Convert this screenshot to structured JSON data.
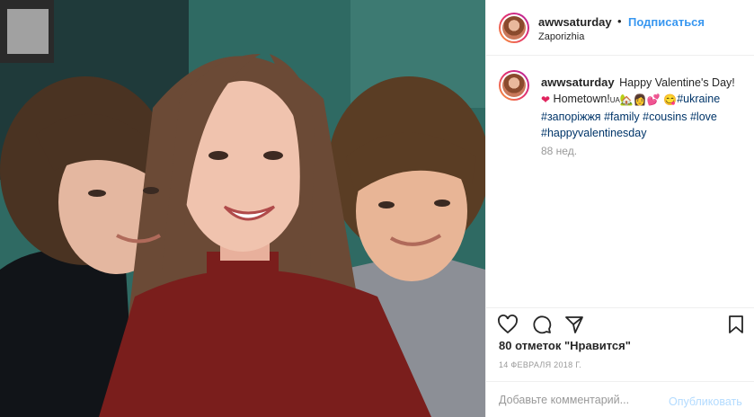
{
  "post": {
    "username": "awwsaturday",
    "separator": "•",
    "follow_label": "Подписаться",
    "location": "Zaporizhia",
    "caption": {
      "text_start": "Happy Valentine's Day!",
      "hometown": "Hometown!",
      "ua_flag": "UA",
      "hashtags": [
        "#ukraine",
        "#запоріжжя",
        "#family",
        "#cousins",
        "#love",
        "#happyvalentinesday"
      ]
    },
    "time_ago": "88 нед.",
    "likes": "80 отметок \"Нравится\"",
    "date": "14 ФЕВРАЛЯ 2018 Г.",
    "comment_placeholder": "Добавьте комментарий...",
    "publish_label": "Опубликовать"
  },
  "icons": {
    "like": "heart-outline-icon",
    "comment": "comment-bubble-icon",
    "share": "paper-plane-icon",
    "save": "bookmark-icon"
  },
  "colors": {
    "accent": "#3897f0",
    "hashtag": "#003569",
    "muted": "#999999",
    "border": "#efefef",
    "publish_disabled": "#b3dbff"
  }
}
